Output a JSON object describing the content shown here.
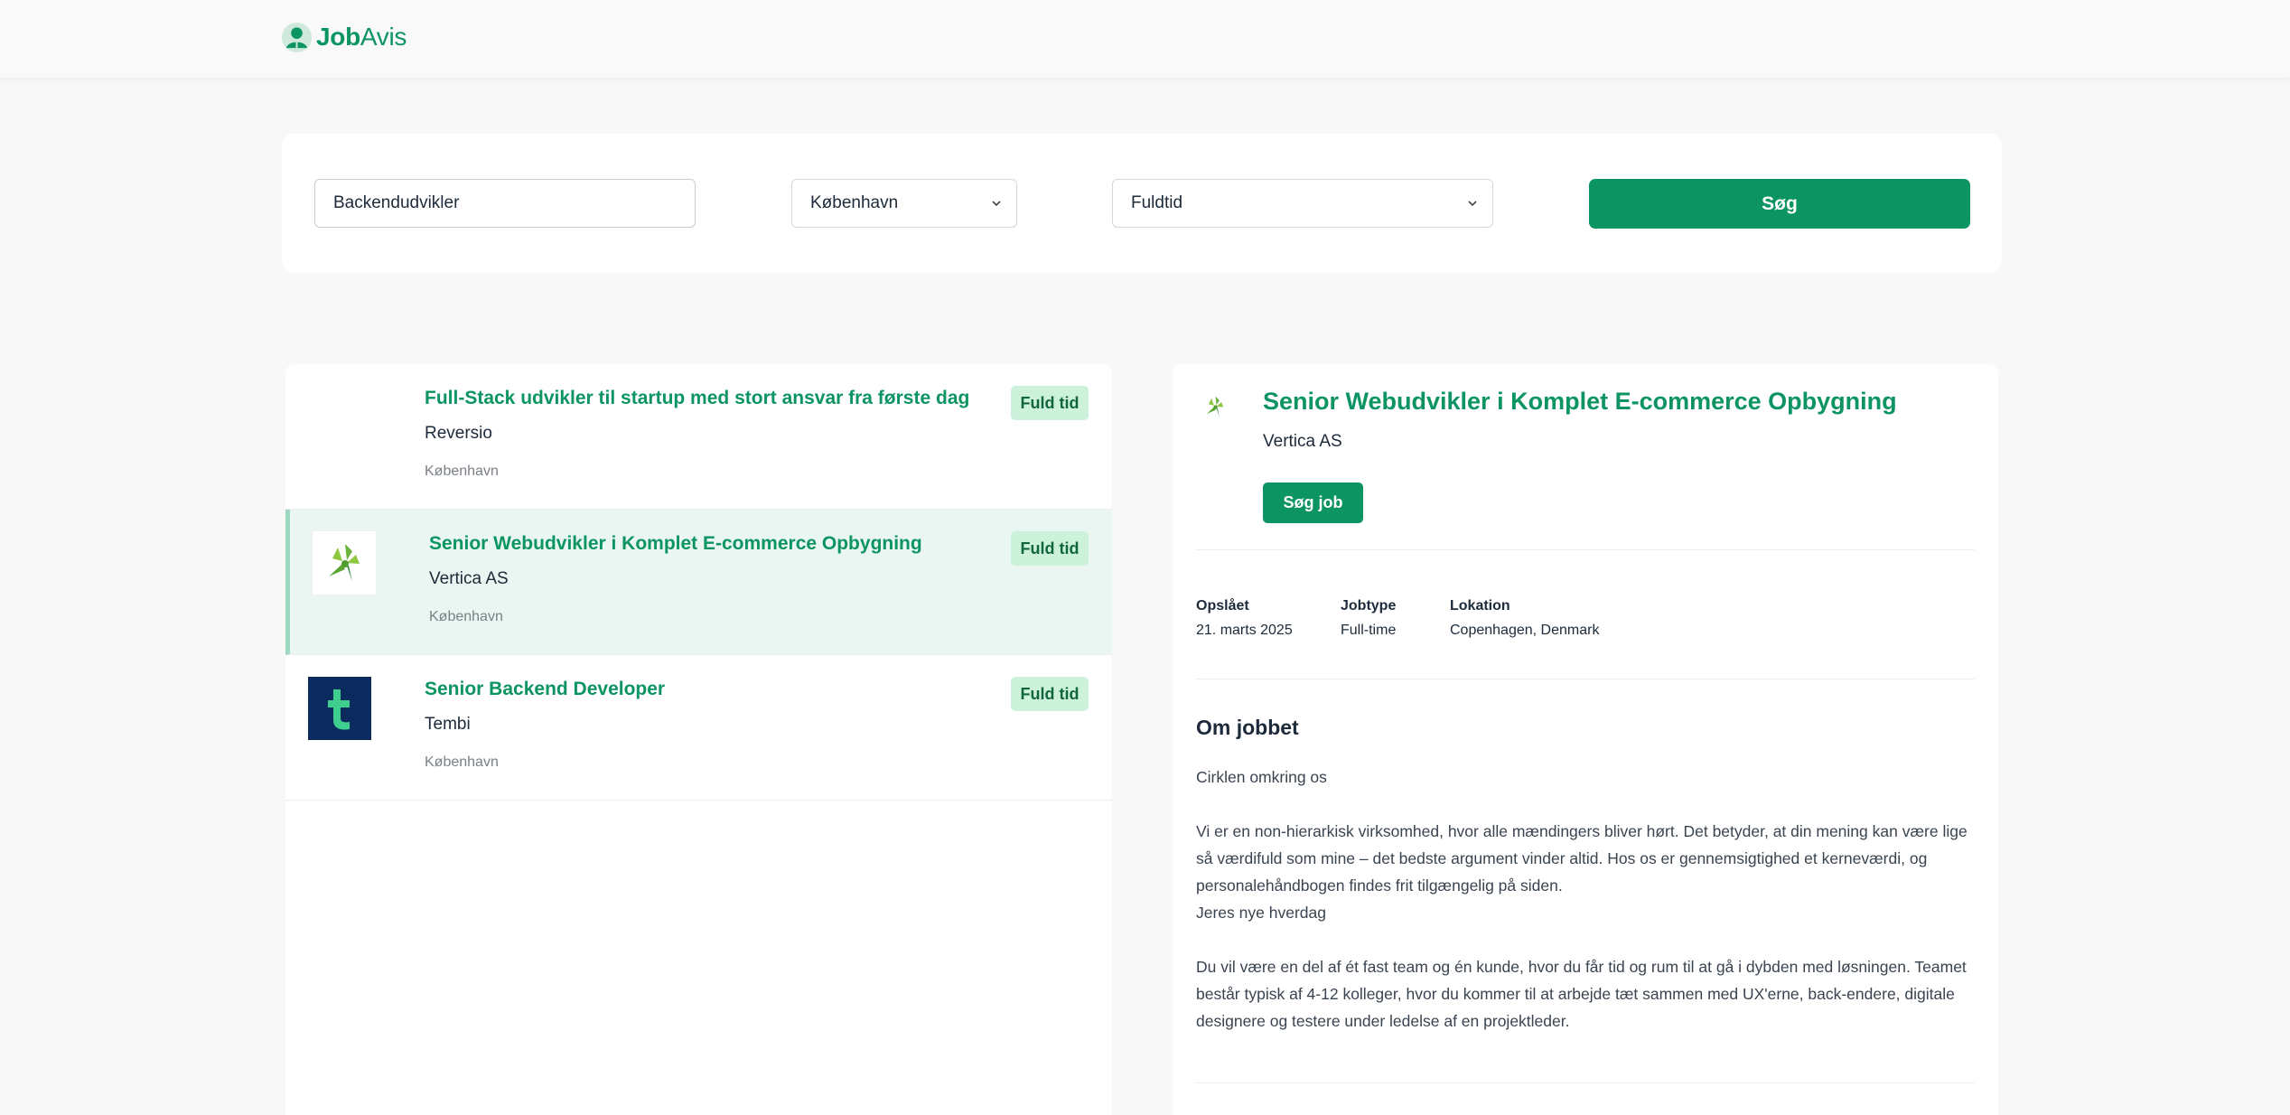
{
  "header": {
    "logo_bold": "Job",
    "logo_regular": "Avis",
    "brand_color": "#0c9462"
  },
  "search": {
    "keyword_value": "Backendudvikler",
    "location_value": "København",
    "jobtype_value": "Fuldtid",
    "button_label": "Søg"
  },
  "jobs": [
    {
      "title": "Full-Stack udvikler til startup med stort ansvar fra første dag",
      "company": "Reversio",
      "location": "København",
      "badge": "Fuld tid",
      "logo": "none",
      "selected": false
    },
    {
      "title": "Senior Webudvikler i Komplet E-commerce Opbygning",
      "company": "Vertica AS",
      "location": "København",
      "badge": "Fuld tid",
      "logo": "vertica-star-logo",
      "selected": true
    },
    {
      "title": "Senior Backend Developer",
      "company": "Tembi",
      "location": "København",
      "badge": "Fuld tid",
      "logo": "tembi-t-logo",
      "selected": false
    }
  ],
  "detail": {
    "title": "Senior Webudvikler i Komplet E-commerce Opbygning",
    "company": "Vertica AS",
    "apply_label": "Søg job",
    "meta": {
      "posted_label": "Opslået",
      "posted_value": "21. marts 2025",
      "jobtype_label": "Jobtype",
      "jobtype_value": "Full-time",
      "location_label": "Lokation",
      "location_value": "Copenhagen, Denmark"
    },
    "about_heading": "Om jobbet",
    "paragraph_1": "Cirklen omkring os",
    "paragraph_2": "Vi er en non-hierarkisk virksomhed, hvor alle mændingers bliver hørt. Det betyder, at din mening kan være lige så værdifuld som mine – det bedste argument vinder altid. Hos os er gennemsigtighed et kerneværdi, og personalehåndbogen findes frit tilgængelig på siden.",
    "paragraph_3": "Jeres nye hverdag",
    "paragraph_4": "Du vil være en del af ét fast team og én kunde, hvor du får tid og rum til at gå i dybden med løsningen. Teamet består typisk af 4-12 kolleger, hvor du kommer til at arbejde tæt sammen med UX'erne, back-endere, digitale designere og testere under ledelse af en projektleder."
  }
}
